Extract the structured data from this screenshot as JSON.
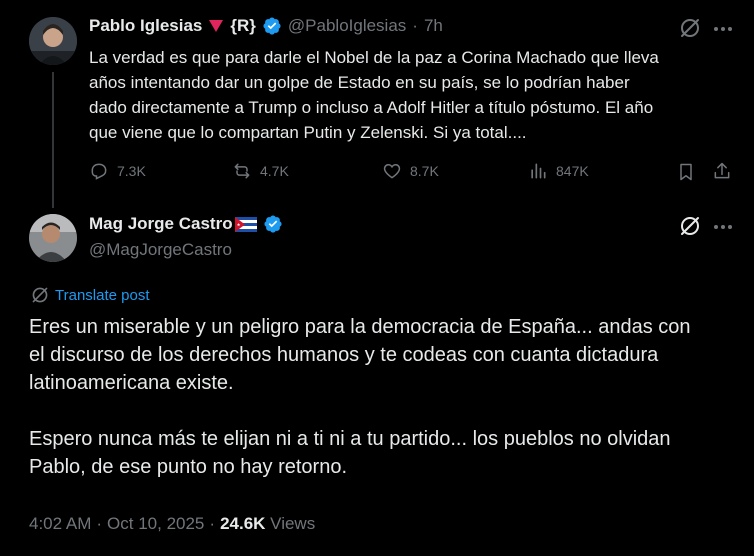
{
  "parent_tweet": {
    "author_name": "Pablo Iglesias",
    "author_badge": "{R}",
    "handle": "@PabloIglesias",
    "time_sep": "·",
    "time": "7h",
    "text_lines": [
      "La verdad es que para darle el Nobel de la paz a Corina Machado que lleva",
      "años intentando dar un golpe de Estado en su país, se lo podrían haber",
      "dado directamente a Trump o incluso a Adolf Hitler a título póstumo. El año",
      "que viene que lo compartan Putin y Zelenski. Si ya total...."
    ],
    "actions": {
      "replies": "7.3K",
      "reposts": "4.7K",
      "likes": "8.7K",
      "views": "847K"
    }
  },
  "reply_tweet": {
    "author_name": "Mag Jorge Castro",
    "handle": "@MagJorgeCastro",
    "translate_label": "Translate post",
    "paragraphs": [
      [
        "Eres un miserable y un peligro para la democracia de España... andas con",
        "el discurso de los derechos humanos y te codeas con cuanta dictadura",
        "latinoamericana existe."
      ],
      [
        "Espero nunca más te elijan ni a ti ni a tu partido... los pueblos no olvidan",
        "Pablo, de ese punto no hay retorno."
      ]
    ],
    "footer": {
      "time": "4:02 AM",
      "sep1": "·",
      "date": "Oct 10, 2025",
      "sep2": "·",
      "views_count": "24.6K",
      "views_label": "Views"
    }
  },
  "icons": {
    "verified": "verified-badge-icon",
    "grok": "grok-icon",
    "more": "more-icon",
    "reply": "reply-icon",
    "repost": "repost-icon",
    "like": "like-icon",
    "views": "views-icon",
    "bookmark": "bookmark-icon",
    "share": "share-icon",
    "translate": "globe-icon",
    "flag": "cuba-flag-icon",
    "triangle": "red-triangle-icon"
  },
  "colors": {
    "background": "#000000",
    "text": "#e7e9ea",
    "muted": "#71767b",
    "accent": "#1d9bf0",
    "triangle": "#e0245e"
  }
}
